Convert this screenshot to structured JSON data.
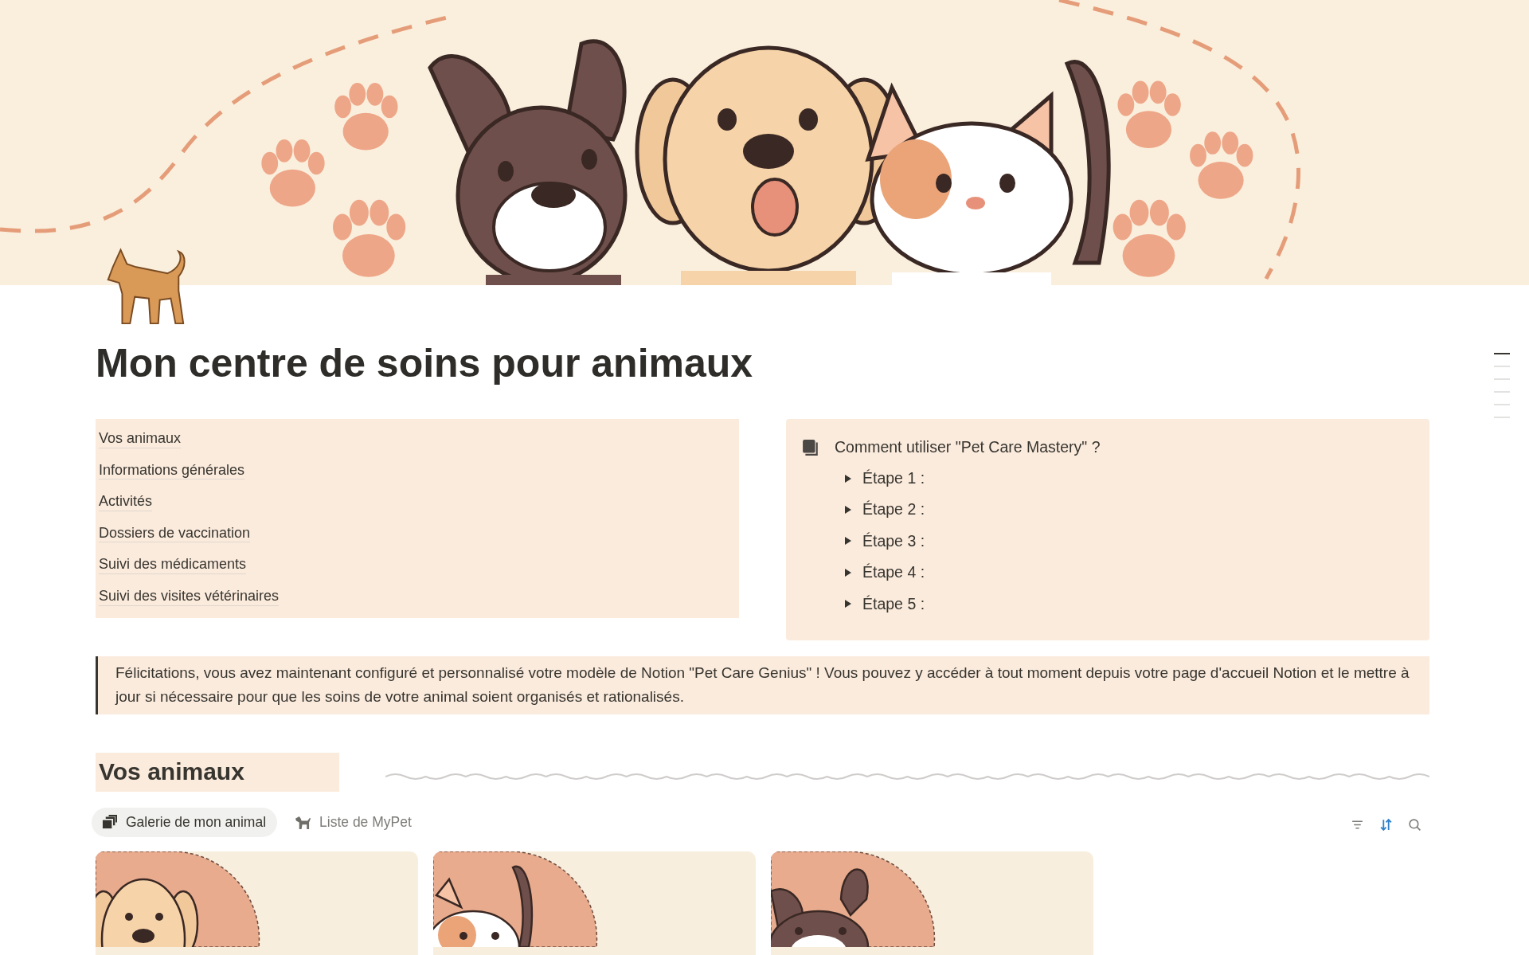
{
  "page": {
    "title": "Mon centre de soins pour animaux"
  },
  "outline_markers": [
    {
      "selected": true
    },
    {
      "selected": false
    },
    {
      "selected": false
    },
    {
      "selected": false
    },
    {
      "selected": false
    },
    {
      "selected": false
    }
  ],
  "table_of_contents": [
    "Vos animaux",
    "Informations générales",
    "Activités",
    "Dossiers de vaccination",
    "Suivi des médicaments",
    "Suivi des visites vétérinaires"
  ],
  "guide": {
    "title": "Comment utiliser \"Pet Care Mastery\" ?",
    "toggles": [
      {
        "label": "Étape 1 :",
        "expanded": false
      },
      {
        "label": "Étape 2 :",
        "expanded": false
      },
      {
        "label": "Étape 3 :",
        "expanded": false
      },
      {
        "label": "Étape 4 :",
        "expanded": false
      },
      {
        "label": "Étape 5 :",
        "expanded": false
      }
    ]
  },
  "quote": "Félicitations, vous avez maintenant configuré et personnalisé votre modèle de Notion \"Pet Care Genius\" ! Vous pouvez y accéder à tout moment depuis votre page d'accueil Notion et le mettre à jour si nécessaire pour que les soins de votre animal soient organisés et rationalisés.",
  "section": {
    "heading": "Vos animaux",
    "views": [
      {
        "label": "Galerie de mon animal",
        "kind": "gallery",
        "selected": true
      },
      {
        "label": "Liste de MyPet",
        "kind": "list",
        "selected": false
      }
    ],
    "toolbar": {
      "sort_active": true
    },
    "cards": [
      {
        "kind": "puppy"
      },
      {
        "kind": "cat"
      },
      {
        "kind": "bulldog"
      }
    ]
  }
}
